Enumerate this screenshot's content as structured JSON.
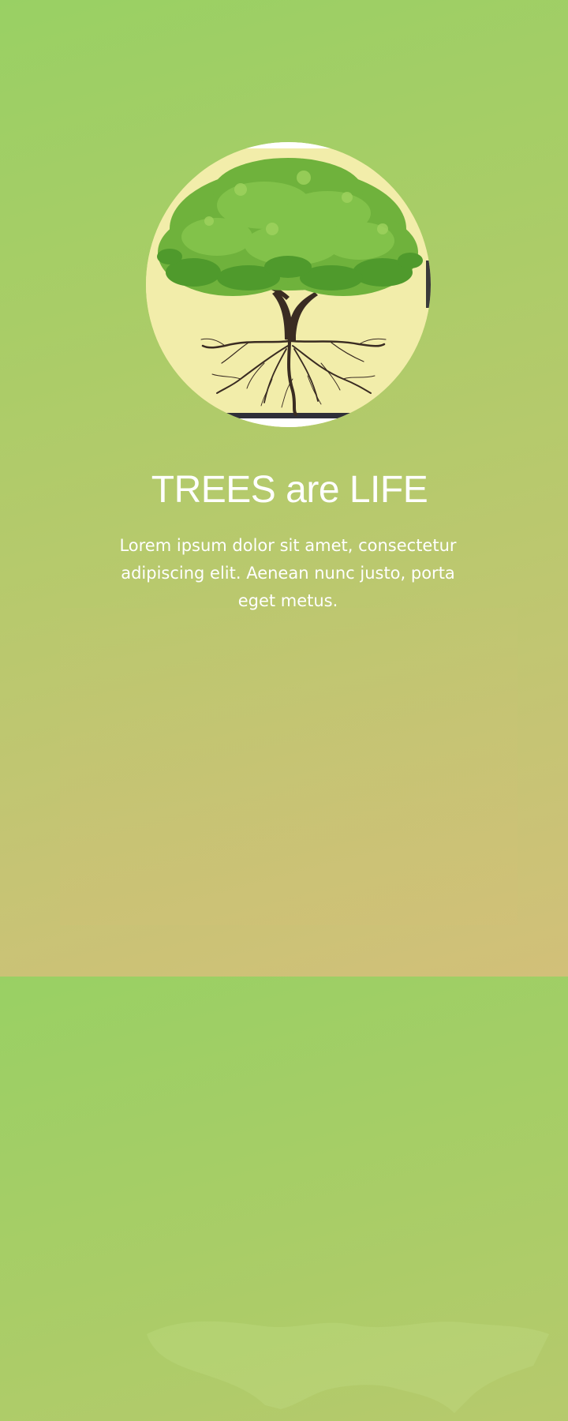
{
  "hero": {
    "image_icon": "tree-with-roots-icon",
    "title": "TREES are LIFE",
    "description": "Lorem ipsum dolor sit amet, consectetur adipiscing elit. Aenean nunc justo, porta eget metus."
  },
  "colors": {
    "background_top": "#99d064",
    "background_bottom": "#d2c079",
    "circle_fill": "#f2edaa",
    "leaf_green": "#6fb23c",
    "root_brown": "#3a2c22",
    "text": "#ffffff"
  }
}
